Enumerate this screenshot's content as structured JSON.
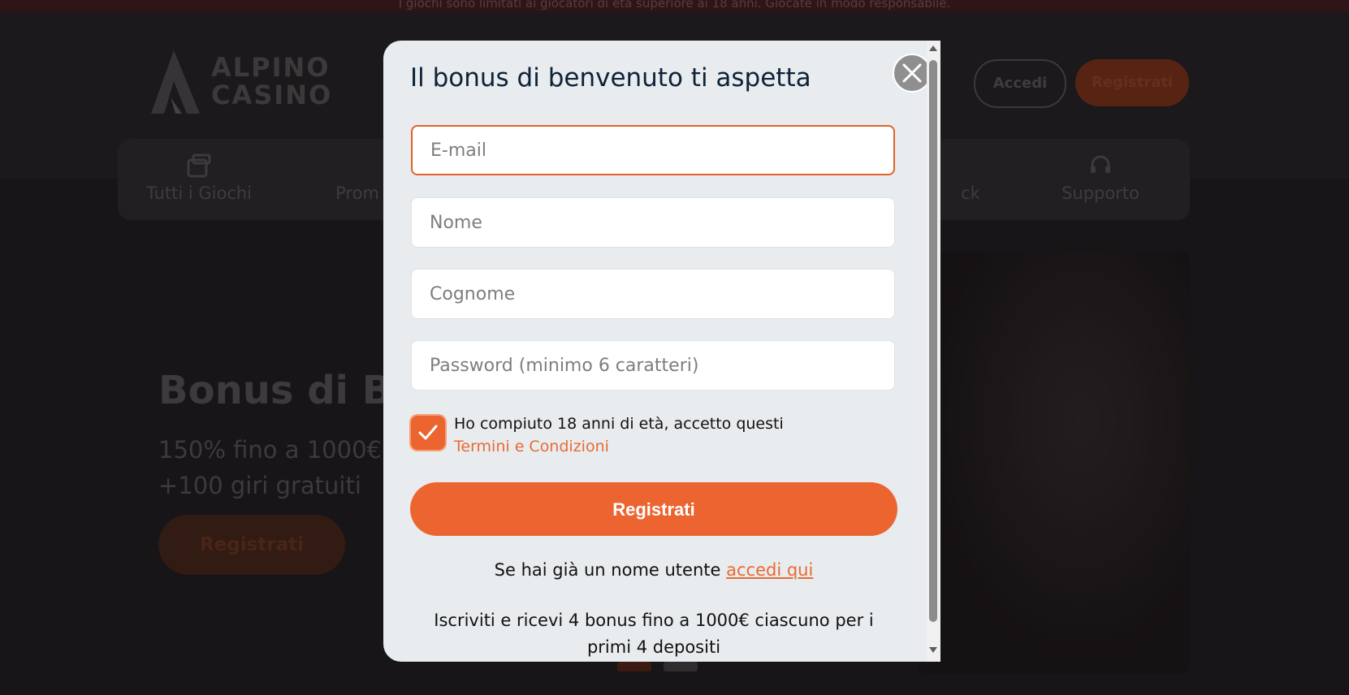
{
  "background": {
    "notice": "I giochi sono limitati ai giocatori di età superiore ai 18 anni. Giocate in modo responsabile.",
    "logo": {
      "line1": "ALPINO",
      "line2": "CASINO"
    },
    "header": {
      "login_label": "Accedi",
      "register_label": "Registrati"
    },
    "nav": [
      {
        "label": "Tutti i Giochi",
        "icon": "slot-icon"
      },
      {
        "label": "Prom",
        "icon": "gift-icon"
      },
      {
        "label": "ck",
        "icon": "cashback-icon"
      },
      {
        "label": "Supporto",
        "icon": "headset-icon"
      }
    ],
    "hero": {
      "title": "Bonus di Be",
      "sub1": "150% fino a 1000€",
      "sub2": "+100 giri gratuiti",
      "button": "Registrati"
    }
  },
  "modal": {
    "title": "Il bonus di benvenuto ti aspetta",
    "fields": {
      "email_placeholder": "E-mail",
      "name_placeholder": "Nome",
      "surname_placeholder": "Cognome",
      "password_placeholder": "Password (minimo 6 caratteri)"
    },
    "consent": {
      "checked": true,
      "text": "Ho compiuto 18 anni di età, accetto questi",
      "link": "Termini e Condizioni"
    },
    "submit_label": "Registrati",
    "login_prompt": "Se hai già un nome utente",
    "login_link": "accedi qui",
    "promo": "Iscriviti e ricevi 4 bonus fino a 1000€ ciascuno per i primi 4 depositi"
  },
  "colors": {
    "accent": "#ec6530",
    "modal_bg": "#e8ecef",
    "title": "#0e2238"
  }
}
